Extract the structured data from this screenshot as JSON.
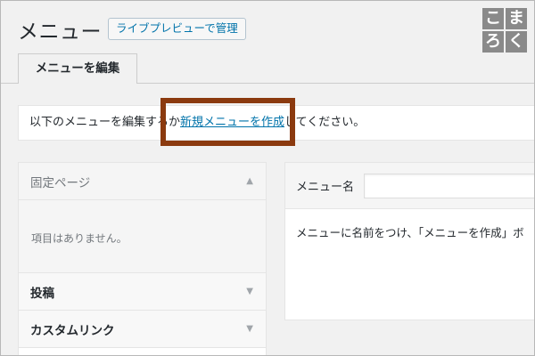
{
  "header": {
    "title": "メニュー",
    "live_preview_button": "ライブプレビューで管理"
  },
  "logo": {
    "chars": [
      "こ",
      "ま",
      "ろ",
      "く"
    ]
  },
  "tabs": [
    {
      "label": "メニューを編集"
    }
  ],
  "notice": {
    "before": "以下のメニューを編集するか",
    "link": "新規メニューを作成",
    "after": "してください。"
  },
  "sidebar": {
    "sections": [
      {
        "label": "固定ページ",
        "expanded": true,
        "empty_text": "項目はありません。"
      },
      {
        "label": "投稿",
        "expanded": false
      },
      {
        "label": "カスタムリンク",
        "expanded": false
      }
    ]
  },
  "menu_panel": {
    "name_label": "メニュー名",
    "name_value": "",
    "instruction": "メニューに名前をつけ、「メニューを作成」ボ"
  },
  "colors": {
    "link": "#0073aa",
    "highlight": "#8b3a0f",
    "logo_bg": "#8a8a8a"
  }
}
